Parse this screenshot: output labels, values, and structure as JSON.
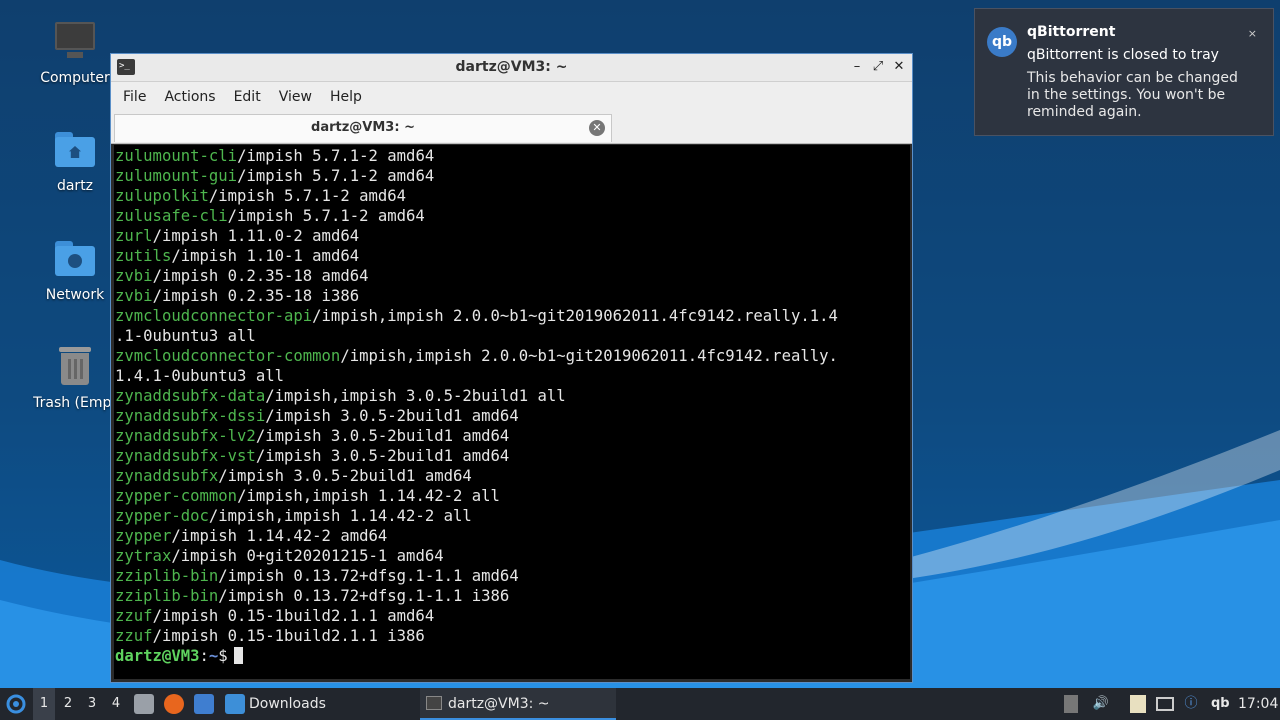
{
  "desktop": {
    "icons": [
      {
        "label": "Computer"
      },
      {
        "label": "dartz"
      },
      {
        "label": "Network"
      },
      {
        "label": "Trash (Empt"
      }
    ]
  },
  "terminal": {
    "window_title": "dartz@VM3: ~",
    "menu": [
      "File",
      "Actions",
      "Edit",
      "View",
      "Help"
    ],
    "tab_title": "dartz@VM3: ~",
    "lines": [
      {
        "pkg": "zulumount-cli",
        "rest": "/impish 5.7.1-2 amd64"
      },
      {
        "pkg": "zulumount-gui",
        "rest": "/impish 5.7.1-2 amd64"
      },
      {
        "pkg": "zulupolkit",
        "rest": "/impish 5.7.1-2 amd64"
      },
      {
        "pkg": "zulusafe-cli",
        "rest": "/impish 5.7.1-2 amd64"
      },
      {
        "pkg": "zurl",
        "rest": "/impish 1.11.0-2 amd64"
      },
      {
        "pkg": "zutils",
        "rest": "/impish 1.10-1 amd64"
      },
      {
        "pkg": "zvbi",
        "rest": "/impish 0.2.35-18 amd64"
      },
      {
        "pkg": "zvbi",
        "rest": "/impish 0.2.35-18 i386"
      },
      {
        "pkg": "zvmcloudconnector-api",
        "rest": "/impish,impish 2.0.0~b1~git2019062011.4fc9142.really.1.4"
      },
      {
        "pkg": "",
        "rest": ".1-0ubuntu3 all"
      },
      {
        "pkg": "zvmcloudconnector-common",
        "rest": "/impish,impish 2.0.0~b1~git2019062011.4fc9142.really."
      },
      {
        "pkg": "",
        "rest": "1.4.1-0ubuntu3 all"
      },
      {
        "pkg": "zynaddsubfx-data",
        "rest": "/impish,impish 3.0.5-2build1 all"
      },
      {
        "pkg": "zynaddsubfx-dssi",
        "rest": "/impish 3.0.5-2build1 amd64"
      },
      {
        "pkg": "zynaddsubfx-lv2",
        "rest": "/impish 3.0.5-2build1 amd64"
      },
      {
        "pkg": "zynaddsubfx-vst",
        "rest": "/impish 3.0.5-2build1 amd64"
      },
      {
        "pkg": "zynaddsubfx",
        "rest": "/impish 3.0.5-2build1 amd64"
      },
      {
        "pkg": "zypper-common",
        "rest": "/impish,impish 1.14.42-2 all"
      },
      {
        "pkg": "zypper-doc",
        "rest": "/impish,impish 1.14.42-2 all"
      },
      {
        "pkg": "zypper",
        "rest": "/impish 1.14.42-2 amd64"
      },
      {
        "pkg": "zytrax",
        "rest": "/impish 0+git20201215-1 amd64"
      },
      {
        "pkg": "zziplib-bin",
        "rest": "/impish 0.13.72+dfsg.1-1.1 amd64"
      },
      {
        "pkg": "zziplib-bin",
        "rest": "/impish 0.13.72+dfsg.1-1.1 i386"
      },
      {
        "pkg": "zzuf",
        "rest": "/impish 0.15-1build2.1.1 amd64"
      },
      {
        "pkg": "zzuf",
        "rest": "/impish 0.15-1build2.1.1 i386"
      }
    ],
    "prompt_user": "dartz@VM3",
    "prompt_colon": ":",
    "prompt_path": "~",
    "prompt_symbol": "$"
  },
  "notification": {
    "app": "qBittorrent",
    "icon_text": "qb",
    "summary": "qBittorrent is closed to tray",
    "body": "This behavior can be changed in the settings. You won't be reminded again.",
    "close": "×"
  },
  "taskbar": {
    "workspaces": [
      "1",
      "2",
      "3",
      "4"
    ],
    "active_workspace": "1",
    "downloads_label": "Downloads",
    "terminal_task_label": "dartz@VM3: ~",
    "tray_qb": "qb",
    "clock": "17:04"
  },
  "colors": {
    "package_name": "#4eb64e",
    "prompt_user": "#5fd35f",
    "prompt_path": "#6a8fd8",
    "window_border": "#5a8fc8"
  }
}
